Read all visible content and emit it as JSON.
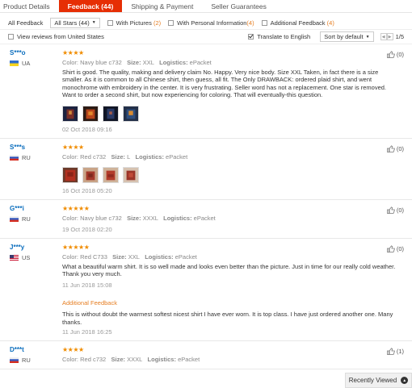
{
  "tabs": [
    {
      "label": "Product Details"
    },
    {
      "label": "Feedback (44)"
    },
    {
      "label": "Shipping & Payment"
    },
    {
      "label": "Seller Guarantees"
    }
  ],
  "filters": {
    "all_feedback": "All Feedback",
    "all_stars": "All Stars (44)",
    "with_pictures_label": "With Pictures",
    "with_pictures_count": "(2)",
    "with_personal_label": "With Personal Information",
    "with_personal_count": "(4)",
    "additional_label": "Additional Feedback",
    "additional_count": "(4)"
  },
  "row2": {
    "view_us": "View reviews from United States",
    "translate": "Translate to English",
    "sort": "Sort by default",
    "page": "1/5"
  },
  "reviews": [
    {
      "user": "S***o",
      "country": "UA",
      "stars": 4,
      "color_label": "Color:",
      "color": "Navy blue c732",
      "size_label": "Size:",
      "size": "XXL",
      "logistics_label": "Logistics:",
      "logistics": "ePacket",
      "text": "Shirt is good. The quality, making and delivery claim No. Happy. Very nice body. Size XXL Taken, in fact there is a size smaller. As it is common to all Chinese shirt, then guess, all fit. The Only DRAWBACK: ordered plaid shirt, and went monochrome with embroidery in the center. It is very frustrating. Seller word has not a replacement. One star is removed. Want to order a second shirt, but now experiencing for coloring. That will eventually-this question.",
      "date": "02 Oct 2018 09:16",
      "helpful": "(0)"
    },
    {
      "user": "S***s",
      "country": "RU",
      "stars": 4,
      "color_label": "Color:",
      "color": "Red c732",
      "size_label": "Size:",
      "size": "L",
      "logistics_label": "Logistics:",
      "logistics": "ePacket",
      "date": "16 Oct 2018 05:20",
      "helpful": "(0)"
    },
    {
      "user": "G***i",
      "country": "RU",
      "stars": 5,
      "color_label": "Color:",
      "color": "Navy blue c732",
      "size_label": "Size:",
      "size": "XXXL",
      "logistics_label": "Logistics:",
      "logistics": "ePacket",
      "date": "19 Oct 2018 02:20",
      "helpful": "(0)"
    },
    {
      "user": "J***y",
      "country": "US",
      "stars": 5,
      "color_label": "Color:",
      "color": "Red C733",
      "size_label": "Size:",
      "size": "XXL",
      "logistics_label": "Logistics:",
      "logistics": "ePacket",
      "text": "What a beautiful warm shirt. It is so well made and looks even better than the picture. Just in time for our really cold weather. Thank you very much.",
      "date": "11 Jun 2018 15:08",
      "additional_title": "Additional Feedback",
      "additional_text": "This is without doubt the warmest softest nicest shirt I have ever worn. It is top class. I have just ordered another one. Many thanks.",
      "additional_date": "11 Jun 2018 16:25",
      "helpful": "(0)"
    },
    {
      "user": "D***t",
      "country": "RU",
      "stars": 4,
      "color_label": "Color:",
      "color": "Red c732",
      "size_label": "Size:",
      "size": "XXXL",
      "logistics_label": "Logistics:",
      "logistics": "ePacket",
      "helpful": "(1)"
    }
  ],
  "recently_viewed": "Recently Viewed",
  "colors": {
    "accent": "#e62e04",
    "star": "#f08c00",
    "link": "#0a6dbd",
    "orange": "#e67e22"
  }
}
